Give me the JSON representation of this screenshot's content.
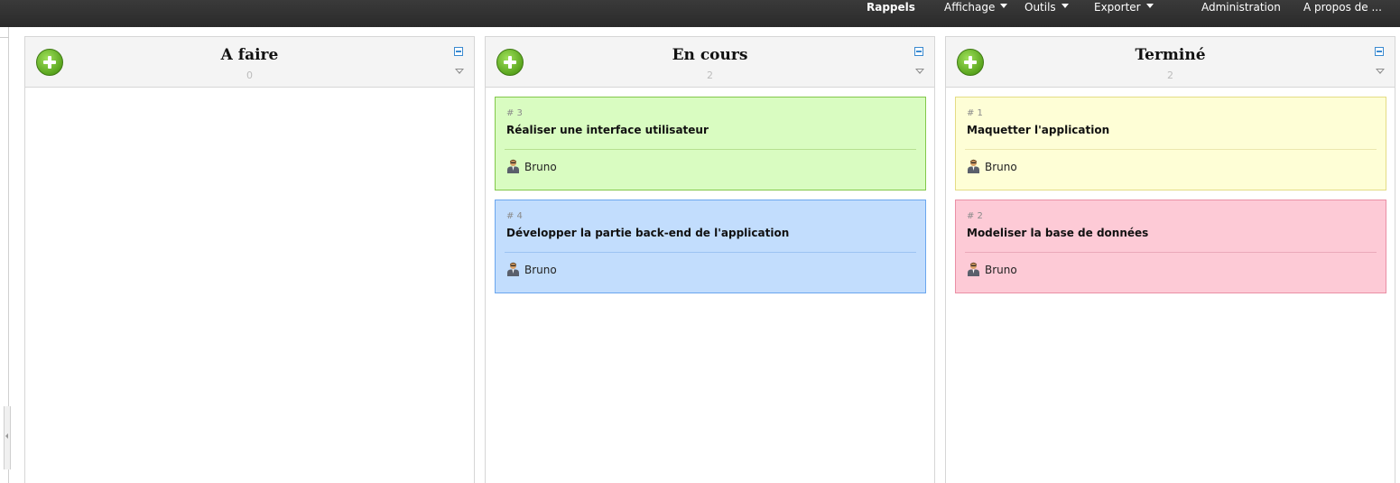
{
  "topbar": {
    "menus": [
      {
        "label": "Rappels",
        "bold": true
      },
      {
        "label": "Affichage",
        "dropdown": true
      },
      {
        "label": "Outils",
        "dropdown": true
      },
      {
        "label": "Exporter",
        "dropdown": true
      },
      {
        "label": "Administration"
      },
      {
        "label": "A propos de ..."
      }
    ]
  },
  "columns": [
    {
      "title": "A faire",
      "count": "0",
      "cards": []
    },
    {
      "title": "En cours",
      "count": "2",
      "cards": [
        {
          "id": "# 3",
          "title": "Réaliser une interface utilisateur",
          "user": "Bruno",
          "color": "#d9fcc1"
        },
        {
          "id": "# 4",
          "title": "Développer la partie back-end de l'application",
          "user": "Bruno",
          "color": "#c2ddfd"
        }
      ]
    },
    {
      "title": "Terminé",
      "count": "2",
      "cards": [
        {
          "id": "# 1",
          "title": "Maquetter l'application",
          "user": "Bruno",
          "color": "#fefed6"
        },
        {
          "id": "# 2",
          "title": "Modeliser la base de données",
          "user": "Bruno",
          "color": "#fdcad6"
        }
      ]
    }
  ],
  "icons": {
    "add": "add-circle-icon",
    "collapse": "collapse-icon",
    "column_menu": "triangle-down-icon",
    "user": "user-icon"
  }
}
